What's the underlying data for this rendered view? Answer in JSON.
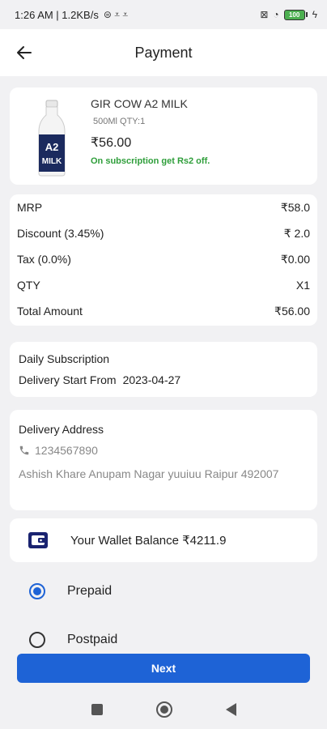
{
  "status_bar": {
    "time_speed": "1:26 AM | 1.2KB/s",
    "battery": "100"
  },
  "header": {
    "title": "Payment"
  },
  "product": {
    "name": "GIR COW A2 MILK",
    "qty": "500Ml QTY:1",
    "price": "₹56.00",
    "promo": "On subscription get Rs2 off.",
    "label_a2": "A2",
    "label_milk": "MILK"
  },
  "summary": {
    "rows": [
      {
        "label": "MRP",
        "value": "₹58.0"
      },
      {
        "label": "Discount (3.45%)",
        "value": "₹ 2.0"
      },
      {
        "label": "Tax (0.0%)",
        "value": "₹0.00"
      },
      {
        "label": "QTY",
        "value": "X1"
      },
      {
        "label": "Total Amount",
        "value": "₹56.00"
      }
    ]
  },
  "subscription": {
    "type": "Daily Subscription",
    "start_label": "Delivery Start From",
    "start_date": "2023-04-27"
  },
  "address": {
    "heading": "Delivery Address",
    "phone": "1234567890",
    "address": "Ashish Khare Anupam Nagar yuuiuu Raipur 492007"
  },
  "wallet": {
    "text": "Your Wallet Balance ₹4211.9"
  },
  "payment_options": [
    {
      "label": "Prepaid",
      "selected": true
    },
    {
      "label": "Postpaid",
      "selected": false
    }
  ],
  "next_button": "Next",
  "colors": {
    "accent": "#1e63d6",
    "promo_green": "#2e9e3a",
    "wallet_navy": "#1a2370"
  }
}
